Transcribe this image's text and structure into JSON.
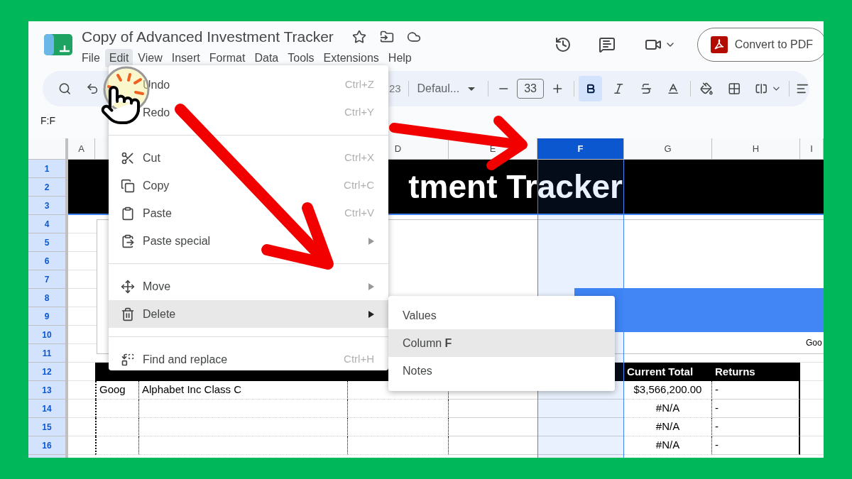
{
  "document": {
    "title": "Copy of Advanced Investment Tracker"
  },
  "menu_bar": [
    {
      "label": "File",
      "selected": false
    },
    {
      "label": "Edit",
      "selected": true
    },
    {
      "label": "View",
      "selected": false
    },
    {
      "label": "Insert",
      "selected": false
    },
    {
      "label": "Format",
      "selected": false
    },
    {
      "label": "Data",
      "selected": false
    },
    {
      "label": "Tools",
      "selected": false
    },
    {
      "label": "Extensions",
      "selected": false
    },
    {
      "label": "Help",
      "selected": false
    }
  ],
  "convert_button": {
    "label": "Convert to PDF"
  },
  "toolbar": {
    "format_text": "23",
    "font": "Defaul...",
    "font_size": "33",
    "bold": true
  },
  "name_box": {
    "value": "F:F"
  },
  "columns": [
    {
      "label": "A",
      "selected": false
    },
    {},
    {},
    {
      "label": "D",
      "selected": false
    },
    {
      "label": "E",
      "selected": false
    },
    {
      "label": "F",
      "selected": true
    },
    {
      "label": "G",
      "selected": false
    },
    {
      "label": "H",
      "selected": false
    },
    {
      "label": "I",
      "selected": false
    }
  ],
  "row_numbers": [
    {
      "label": "1",
      "selected": true
    },
    {
      "label": "2",
      "selected": true
    },
    {
      "label": "3",
      "selected": true
    },
    {
      "label": "4",
      "selected": true
    },
    {
      "label": "5",
      "selected": true
    },
    {
      "label": "6",
      "selected": true
    },
    {
      "label": "7",
      "selected": true
    },
    {
      "label": "8",
      "selected": true
    },
    {
      "label": "9",
      "selected": true
    },
    {
      "label": "10",
      "selected": true
    },
    {
      "label": "11",
      "selected": true
    },
    {
      "label": "12",
      "selected": true
    },
    {
      "label": "13",
      "selected": true
    },
    {
      "label": "14",
      "selected": true
    },
    {
      "label": "15",
      "selected": true
    },
    {
      "label": "16",
      "selected": true
    },
    {
      "selected": true
    }
  ],
  "sheet_title": {
    "text": "tment Tracker"
  },
  "chart_box": {
    "label": "Goo"
  },
  "table": {
    "rows": [
      {
        "kind": "header",
        "cells": {
          "g": "Current Total",
          "h": "Returns"
        }
      },
      {
        "kind": "data",
        "cells": {
          "b": "Goog",
          "c": "Alphabet Inc Class C",
          "g": "$3,566,200.00",
          "h": "-"
        }
      },
      {
        "kind": "data",
        "cells": {
          "g": "#N/A",
          "h": "-"
        }
      },
      {
        "kind": "data",
        "cells": {
          "g": "#N/A",
          "h": "-"
        }
      },
      {
        "kind": "data",
        "cells": {
          "g": "#N/A",
          "h": "-"
        }
      }
    ]
  },
  "edit_menu": {
    "items": [
      {
        "kind": "item",
        "label": "Undo",
        "shortcut": "Ctrl+Z",
        "selected": false
      },
      {
        "kind": "item",
        "label": "Redo",
        "shortcut": "Ctrl+Y",
        "selected": false
      },
      {
        "kind": "divider"
      },
      {
        "kind": "item",
        "label": "Cut",
        "shortcut": "Ctrl+X",
        "selected": false
      },
      {
        "kind": "item",
        "label": "Copy",
        "shortcut": "Ctrl+C",
        "selected": false
      },
      {
        "kind": "item",
        "label": "Paste",
        "shortcut": "Ctrl+V",
        "selected": false
      },
      {
        "kind": "item",
        "label": "Paste special",
        "submenu": true,
        "selected": false
      },
      {
        "kind": "divider"
      },
      {
        "kind": "item",
        "label": "Move",
        "submenu": true,
        "selected": false
      },
      {
        "kind": "item",
        "label": "Delete",
        "submenu": true,
        "selected": true
      },
      {
        "kind": "divider"
      },
      {
        "kind": "item",
        "label": "Find and replace",
        "shortcut": "Ctrl+H",
        "selected": false
      }
    ]
  },
  "delete_submenu": {
    "items": [
      {
        "label": "Values",
        "selected": false
      },
      {
        "label": "Column **F**",
        "selected": true
      },
      {
        "label": "Notes",
        "selected": false
      }
    ]
  }
}
